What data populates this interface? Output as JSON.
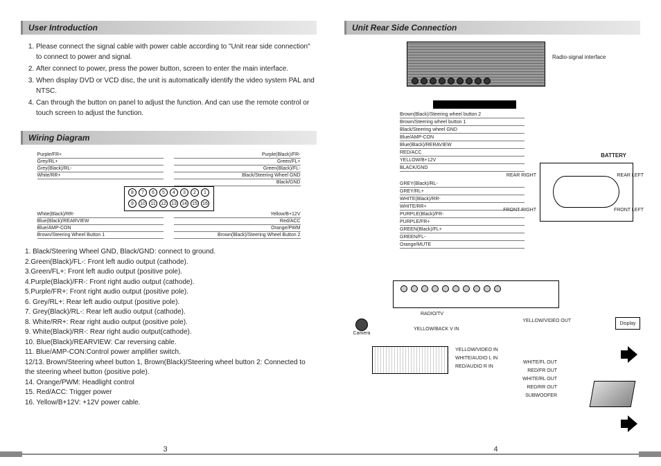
{
  "leftPage": {
    "section1Title": "User Introduction",
    "intro": [
      "Please connect the signal cable with power cable according to \"Unit rear side connection\" to connect to power and signal.",
      "After connect to power, press the power button, screen to enter the main interface.",
      "When display DVD or VCD disc, the unit is automatically identify the video system PAL and NTSC.",
      "Can through the button on panel to adjust the function. And can use the remote control or touch screen to adjust the function."
    ],
    "section2Title": "Wiring Diagram",
    "connectorPinsTop": [
      "8",
      "7",
      "6",
      "5",
      "4",
      "3",
      "2",
      "1"
    ],
    "connectorPinsBottom": [
      "9",
      "10",
      "11",
      "12",
      "13",
      "14",
      "15",
      "16"
    ],
    "topLeftWires": [
      "Purple/FR+",
      "Grey/RL+",
      "Grey(Black)/RL-",
      "White/RR+"
    ],
    "topRightWires": [
      "Purple(Black)/FR-",
      "Green/FL+",
      "Green(Black)/FL-",
      "Black/Steering Wheel GND",
      "Black/GND"
    ],
    "bottomLeftWires": [
      "White(Black)/RR-",
      "Blue(Black)/REARVIEW",
      "Blue/AMP-CON",
      "Brown/Steering Wheel Button 1"
    ],
    "bottomRightWires": [
      "Yellow/B+12V",
      "Red/ACC",
      "Orange/PWM",
      "Brown(Black)/Steering Wheel Button 2"
    ],
    "wiringNotes": [
      "1. Black/Steering Wheel GND, Black/GND: connect to ground.",
      "2.Green(Black)/FL-: Front left audio output (cathode).",
      "3.Green/FL+: Front left audio output (positive pole).",
      "4.Purple(Black)/FR-: Front right audio output (cathode).",
      "5.Purple/FR+: Front right audio output (positive pole).",
      "6. Grey/RL+: Rear left audio output (positive pole).",
      "7. Grey(Black)/RL-: Rear left audio output (cathode).",
      "8. White/RR+: Rear right audio output (positive pole).",
      "9. White(Black)/RR-: Rear right audio output(cathode).",
      "10. Blue(Black)/REARVIEW: Car reversing cable.",
      "11. Blue/AMP-CON:Control power amplifier switch.",
      "12/13. Brown/Steering wheel button 1, Brown(Black)/Steering wheel button 2: Connected to the steering wheel button (positive pole).",
      "14. Orange/PWM: Headlight control",
      "15. Red/ACC: Trigger power",
      "16. Yellow/B+12V: +12V power cable."
    ],
    "pageNumber": "3"
  },
  "rightPage": {
    "sectionTitle": "Unit Rear Side Connection",
    "radioSignalLabel": "Radio-signal interface",
    "harnessA": [
      "Brown(Black)/Steering wheel button 2",
      "Brown/Steering wheel button 1",
      "Black/Steering wheel GND",
      "Blue/AMP-CON",
      "Blue(Black)/RERAVIEW",
      "RED/ACC",
      "YELLOW/B+12V",
      "BLACK/GND"
    ],
    "harnessB": [
      "GREY(Black)/RL-",
      "GREY/RL+",
      "WHITE(Black)/RR-",
      "WHITE/RR+",
      "PURPLE(Black)/FR-",
      "PURPLE/FR+",
      "GREEN(Black)/FL+",
      "GREEN/FL-",
      "Orange/MUTE"
    ],
    "carLabels": {
      "battery": "BATTERY",
      "rearRight": "REAR RIGHT",
      "rearLeft": "REAR LEFT",
      "frontRight": "FRONT RIGHT",
      "frontLeft": "FRONT LEFT"
    },
    "cameraLabel": "Camera",
    "displayLabel": "Display",
    "rcaLeft": [
      "RADIO/TV",
      "YELLOW/BACK V IN",
      "YELLOW/VIDEO IN",
      "WHITE/AUDIO L IN",
      "RED/AUDIO R IN"
    ],
    "rcaRightTop": "YELLOW/VIDEO OUT",
    "rcaRightOuts": [
      "WHITE/FL OUT",
      "RED/FR OUT",
      "WHITE/RL OUT",
      "RED/RR OUT",
      "SUBWOOFER"
    ],
    "pageNumber": "4"
  }
}
